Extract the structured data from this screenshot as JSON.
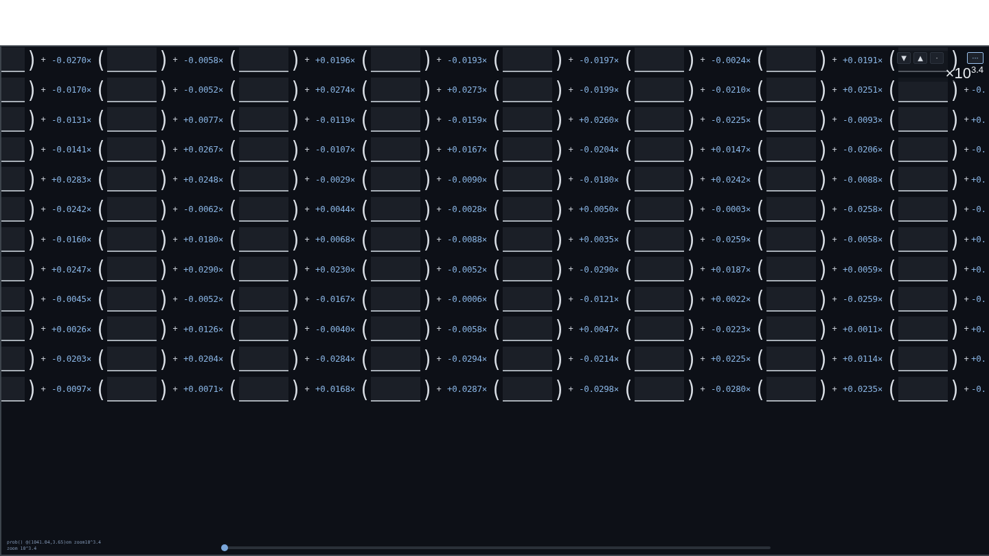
{
  "rows": [
    {
      "lead_close": ")",
      "terms": [
        {
          "plus": "+",
          "coefficient": "-0.0270×",
          "open": "(",
          "close": ")"
        },
        {
          "plus": "+",
          "coefficient": "-0.0058×",
          "open": "(",
          "close": ")"
        },
        {
          "plus": "+",
          "coefficient": "+0.0196×",
          "open": "(",
          "close": ")"
        },
        {
          "plus": "+",
          "coefficient": "-0.0193×",
          "open": "(",
          "close": ")"
        },
        {
          "plus": "+",
          "coefficient": "-0.0197×",
          "open": "(",
          "close": ")"
        },
        {
          "plus": "+",
          "coefficient": "-0.0024×",
          "open": "(",
          "close": ")"
        },
        {
          "plus": "+",
          "coefficient": "+0.0191×",
          "open": "(",
          "close": ")"
        }
      ]
    },
    {
      "lead_close": ")",
      "terms": [
        {
          "plus": "+",
          "coefficient": "-0.0170×",
          "open": "(",
          "close": ")"
        },
        {
          "plus": "+",
          "coefficient": "-0.0052×",
          "open": "(",
          "close": ")"
        },
        {
          "plus": "+",
          "coefficient": "+0.0274×",
          "open": "(",
          "close": ")"
        },
        {
          "plus": "+",
          "coefficient": "+0.0273×",
          "open": "(",
          "close": ")"
        },
        {
          "plus": "+",
          "coefficient": "-0.0199×",
          "open": "(",
          "close": ")"
        },
        {
          "plus": "+",
          "coefficient": "-0.0210×",
          "open": "(",
          "close": ")"
        },
        {
          "plus": "+",
          "coefficient": "+0.0251×",
          "open": "(",
          "close": ")"
        }
      ],
      "tail": {
        "plus": "+",
        "coefficient": "-0."
      }
    },
    {
      "lead_close": ")",
      "terms": [
        {
          "plus": "+",
          "coefficient": "-0.0131×",
          "open": "(",
          "close": ")"
        },
        {
          "plus": "+",
          "coefficient": "+0.0077×",
          "open": "(",
          "close": ")"
        },
        {
          "plus": "+",
          "coefficient": "-0.0119×",
          "open": "(",
          "close": ")"
        },
        {
          "plus": "+",
          "coefficient": "-0.0159×",
          "open": "(",
          "close": ")"
        },
        {
          "plus": "+",
          "coefficient": "+0.0260×",
          "open": "(",
          "close": ")"
        },
        {
          "plus": "+",
          "coefficient": "-0.0225×",
          "open": "(",
          "close": ")"
        },
        {
          "plus": "+",
          "coefficient": "-0.0093×",
          "open": "(",
          "close": ")"
        }
      ],
      "tail": {
        "plus": "+",
        "coefficient": "+0."
      }
    },
    {
      "lead_close": ")",
      "terms": [
        {
          "plus": "+",
          "coefficient": "-0.0141×",
          "open": "(",
          "close": ")"
        },
        {
          "plus": "+",
          "coefficient": "+0.0267×",
          "open": "(",
          "close": ")"
        },
        {
          "plus": "+",
          "coefficient": "-0.0107×",
          "open": "(",
          "close": ")"
        },
        {
          "plus": "+",
          "coefficient": "+0.0167×",
          "open": "(",
          "close": ")"
        },
        {
          "plus": "+",
          "coefficient": "-0.0204×",
          "open": "(",
          "close": ")"
        },
        {
          "plus": "+",
          "coefficient": "+0.0147×",
          "open": "(",
          "close": ")"
        },
        {
          "plus": "+",
          "coefficient": "-0.0206×",
          "open": "(",
          "close": ")"
        }
      ],
      "tail": {
        "plus": "+",
        "coefficient": "-0."
      }
    },
    {
      "lead_close": ")",
      "terms": [
        {
          "plus": "+",
          "coefficient": "+0.0283×",
          "open": "(",
          "close": ")"
        },
        {
          "plus": "+",
          "coefficient": "+0.0248×",
          "open": "(",
          "close": ")"
        },
        {
          "plus": "+",
          "coefficient": "-0.0029×",
          "open": "(",
          "close": ")"
        },
        {
          "plus": "+",
          "coefficient": "-0.0090×",
          "open": "(",
          "close": ")"
        },
        {
          "plus": "+",
          "coefficient": "-0.0180×",
          "open": "(",
          "close": ")"
        },
        {
          "plus": "+",
          "coefficient": "+0.0242×",
          "open": "(",
          "close": ")"
        },
        {
          "plus": "+",
          "coefficient": "-0.0088×",
          "open": "(",
          "close": ")"
        }
      ],
      "tail": {
        "plus": "+",
        "coefficient": "+0."
      }
    },
    {
      "lead_close": ")",
      "terms": [
        {
          "plus": "+",
          "coefficient": "-0.0242×",
          "open": "(",
          "close": ")"
        },
        {
          "plus": "+",
          "coefficient": "-0.0062×",
          "open": "(",
          "close": ")"
        },
        {
          "plus": "+",
          "coefficient": "+0.0044×",
          "open": "(",
          "close": ")"
        },
        {
          "plus": "+",
          "coefficient": "-0.0028×",
          "open": "(",
          "close": ")"
        },
        {
          "plus": "+",
          "coefficient": "+0.0050×",
          "open": "(",
          "close": ")"
        },
        {
          "plus": "+",
          "coefficient": "-0.0003×",
          "open": "(",
          "close": ")"
        },
        {
          "plus": "+",
          "coefficient": "-0.0258×",
          "open": "(",
          "close": ")"
        }
      ],
      "tail": {
        "plus": "+",
        "coefficient": "-0."
      }
    },
    {
      "lead_close": ")",
      "terms": [
        {
          "plus": "+",
          "coefficient": "-0.0160×",
          "open": "(",
          "close": ")"
        },
        {
          "plus": "+",
          "coefficient": "+0.0180×",
          "open": "(",
          "close": ")"
        },
        {
          "plus": "+",
          "coefficient": "+0.0068×",
          "open": "(",
          "close": ")"
        },
        {
          "plus": "+",
          "coefficient": "-0.0088×",
          "open": "(",
          "close": ")"
        },
        {
          "plus": "+",
          "coefficient": "+0.0035×",
          "open": "(",
          "close": ")"
        },
        {
          "plus": "+",
          "coefficient": "-0.0259×",
          "open": "(",
          "close": ")"
        },
        {
          "plus": "+",
          "coefficient": "-0.0058×",
          "open": "(",
          "close": ")"
        }
      ],
      "tail": {
        "plus": "+",
        "coefficient": "+0."
      }
    },
    {
      "lead_close": ")",
      "terms": [
        {
          "plus": "+",
          "coefficient": "+0.0247×",
          "open": "(",
          "close": ")"
        },
        {
          "plus": "+",
          "coefficient": "+0.0290×",
          "open": "(",
          "close": ")"
        },
        {
          "plus": "+",
          "coefficient": "+0.0230×",
          "open": "(",
          "close": ")"
        },
        {
          "plus": "+",
          "coefficient": "-0.0052×",
          "open": "(",
          "close": ")"
        },
        {
          "plus": "+",
          "coefficient": "-0.0290×",
          "open": "(",
          "close": ")"
        },
        {
          "plus": "+",
          "coefficient": "+0.0187×",
          "open": "(",
          "close": ")"
        },
        {
          "plus": "+",
          "coefficient": "+0.0059×",
          "open": "(",
          "close": ")"
        }
      ],
      "tail": {
        "plus": "+",
        "coefficient": "+0."
      }
    },
    {
      "lead_close": ")",
      "terms": [
        {
          "plus": "+",
          "coefficient": "-0.0045×",
          "open": "(",
          "close": ")"
        },
        {
          "plus": "+",
          "coefficient": "-0.0052×",
          "open": "(",
          "close": ")"
        },
        {
          "plus": "+",
          "coefficient": "-0.0167×",
          "open": "(",
          "close": ")"
        },
        {
          "plus": "+",
          "coefficient": "-0.0006×",
          "open": "(",
          "close": ")"
        },
        {
          "plus": "+",
          "coefficient": "-0.0121×",
          "open": "(",
          "close": ")"
        },
        {
          "plus": "+",
          "coefficient": "+0.0022×",
          "open": "(",
          "close": ")"
        },
        {
          "plus": "+",
          "coefficient": "-0.0259×",
          "open": "(",
          "close": ")"
        }
      ],
      "tail": {
        "plus": "+",
        "coefficient": "-0."
      }
    },
    {
      "lead_close": ")",
      "terms": [
        {
          "plus": "+",
          "coefficient": "+0.0026×",
          "open": "(",
          "close": ")"
        },
        {
          "plus": "+",
          "coefficient": "+0.0126×",
          "open": "(",
          "close": ")"
        },
        {
          "plus": "+",
          "coefficient": "-0.0040×",
          "open": "(",
          "close": ")"
        },
        {
          "plus": "+",
          "coefficient": "-0.0058×",
          "open": "(",
          "close": ")"
        },
        {
          "plus": "+",
          "coefficient": "+0.0047×",
          "open": "(",
          "close": ")"
        },
        {
          "plus": "+",
          "coefficient": "-0.0223×",
          "open": "(",
          "close": ")"
        },
        {
          "plus": "+",
          "coefficient": "+0.0011×",
          "open": "(",
          "close": ")"
        }
      ],
      "tail": {
        "plus": "+",
        "coefficient": "+0."
      }
    },
    {
      "lead_close": ")",
      "terms": [
        {
          "plus": "+",
          "coefficient": "-0.0203×",
          "open": "(",
          "close": ")"
        },
        {
          "plus": "+",
          "coefficient": "+0.0204×",
          "open": "(",
          "close": ")"
        },
        {
          "plus": "+",
          "coefficient": "-0.0284×",
          "open": "(",
          "close": ")"
        },
        {
          "plus": "+",
          "coefficient": "-0.0294×",
          "open": "(",
          "close": ")"
        },
        {
          "plus": "+",
          "coefficient": "-0.0214×",
          "open": "(",
          "close": ")"
        },
        {
          "plus": "+",
          "coefficient": "+0.0225×",
          "open": "(",
          "close": ")"
        },
        {
          "plus": "+",
          "coefficient": "+0.0114×",
          "open": "(",
          "close": ")"
        }
      ],
      "tail": {
        "plus": "+",
        "coefficient": "+0."
      }
    },
    {
      "lead_close": ")",
      "terms": [
        {
          "plus": "+",
          "coefficient": "-0.0097×",
          "open": "(",
          "close": ")"
        },
        {
          "plus": "+",
          "coefficient": "+0.0071×",
          "open": "(",
          "close": ")"
        },
        {
          "plus": "+",
          "coefficient": "+0.0168×",
          "open": "(",
          "close": ")"
        },
        {
          "plus": "+",
          "coefficient": "+0.0287×",
          "open": "(",
          "close": ")"
        },
        {
          "plus": "+",
          "coefficient": "-0.0298×",
          "open": "(",
          "close": ")"
        },
        {
          "plus": "+",
          "coefficient": "-0.0280×",
          "open": "(",
          "close": ")"
        },
        {
          "plus": "+",
          "coefficient": "+0.0235×",
          "open": "(",
          "close": ")"
        }
      ],
      "tail": {
        "plus": "+",
        "coefficient": "-0."
      }
    }
  ],
  "toolbar": [
    {
      "label": "▼",
      "selected": false
    },
    {
      "label": "▲",
      "selected": false
    },
    {
      "label": "·",
      "selected": false
    },
    {
      "label": "···",
      "selected": true
    }
  ],
  "zoom_label": "×10$^{3.4}$",
  "status_lines": [
    "prob() @(1041.04,3.65)em zoom10^3.4",
    "zoom 10^3.4"
  ],
  "slider": {
    "level": 0
  }
}
